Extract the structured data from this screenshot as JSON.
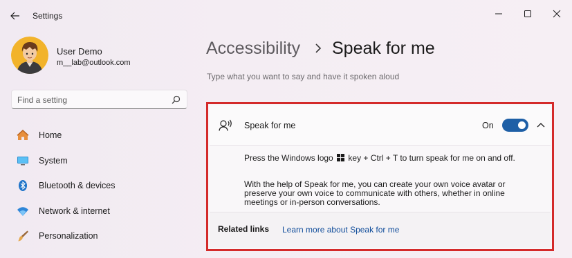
{
  "window": {
    "title": "Settings",
    "back_icon": "arrow-left-icon",
    "controls": [
      "minimize-icon",
      "maximize-icon",
      "close-icon"
    ]
  },
  "user": {
    "name": "User Demo",
    "email": "m__lab@outlook.com",
    "avatar_icon": "user-avatar"
  },
  "search": {
    "placeholder": "Find a setting",
    "value": "",
    "icon": "search-icon"
  },
  "sidebar": {
    "items": [
      {
        "label": "Home",
        "icon": "home-icon"
      },
      {
        "label": "System",
        "icon": "monitor-icon"
      },
      {
        "label": "Bluetooth & devices",
        "icon": "bluetooth-icon"
      },
      {
        "label": "Network & internet",
        "icon": "wifi-icon"
      },
      {
        "label": "Personalization",
        "icon": "brush-icon"
      }
    ]
  },
  "main": {
    "breadcrumb": {
      "parent": "Accessibility",
      "separator_icon": "chevron-right-icon",
      "current": "Speak for me"
    },
    "description": "Type what you want to say and have it spoken aloud",
    "card": {
      "icon": "speak-icon",
      "title": "Speak for me",
      "toggle_state": "On",
      "toggle_on": true,
      "expanded": true,
      "body_p1_before": "Press the Windows logo",
      "body_p1_after": "key + Ctrl + T to turn speak for me on and off.",
      "body_p2": "With the help of Speak for me, you can create your own voice avatar or preserve your own voice to communicate with others, whether in online meetings or in-person conversations.",
      "related_label": "Related links",
      "related_link": "Learn more about Speak for me"
    }
  },
  "colors": {
    "accent": "#1e5fa6",
    "highlight_border": "#d42a2a",
    "link": "#0f4c9a"
  }
}
